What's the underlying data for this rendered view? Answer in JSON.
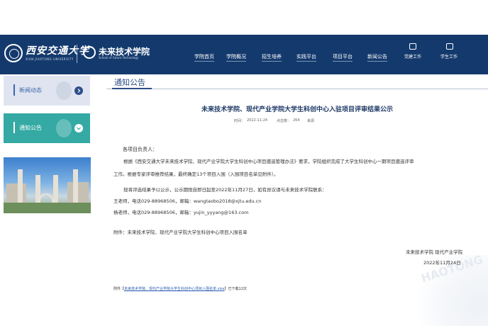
{
  "header": {
    "xjtu_name": "西安交通大学",
    "xjtu_sub": "XIAN JIAOTONG UNIVERSITY",
    "school_name": "未来技术学院",
    "school_sub": "School of Future Technology",
    "nav": [
      "学院首页",
      "学院概况",
      "招生培养",
      "实践平台",
      "项目平台",
      "新闻公告"
    ],
    "right_links": [
      "党建工作",
      "学生工作"
    ],
    "colors": {
      "header_bg": "#143a6d",
      "sidebar_active": "#35a9a4"
    }
  },
  "sidebar": {
    "items": [
      {
        "label": "新闻动态",
        "icon": "chevron-right-icon"
      },
      {
        "label": "通知公告",
        "icon": "chevron-down-icon"
      }
    ]
  },
  "section": {
    "title": "通知公告"
  },
  "article": {
    "title": "未来技术学院、现代产业学院大学生科创中心入驻项目评审结果公示",
    "time_label": "时间：",
    "time_value": "2022-11-24",
    "views_label": "点击数：",
    "views_value": "264",
    "extra": "来源",
    "salutation": "各项目负责人：",
    "para1_line1": "根据《西安交通大学未来技术学院、现代产业学院大学生科创中心项目遴选管理办法》要求，学院组织完成了大学生科创中心一期项目遴选评审",
    "para1_line2": "工作。根据专家评审推荐结果，最终确定13个项目入围（入围项目名单见附件）。",
    "para2": "现将评选结果予以公示，公示期限自即日起至2022年11月27日，如有异议请与未来技术学院联系：",
    "contact1": "王老师，电话029-88968506，邮箱：wangtaobo2018@xjtu.edu.cn",
    "contact2": "杨老师，电话029-88968506，邮箱：yujin_yyyang@163.com",
    "attachment_note": "附件：未来技术学院、现代产业学院大学生科创中心项目入围名单",
    "sign_org": "未来技术学院  现代产业学院",
    "sign_date": "2022年11月24日",
    "attach_label": "附件【",
    "attach_file": "未来技术学院、现代产业学院大学生科创中心项目入围名单.xlsx",
    "attach_close": "】已下载",
    "attach_count": "12",
    "attach_suffix": "次"
  }
}
